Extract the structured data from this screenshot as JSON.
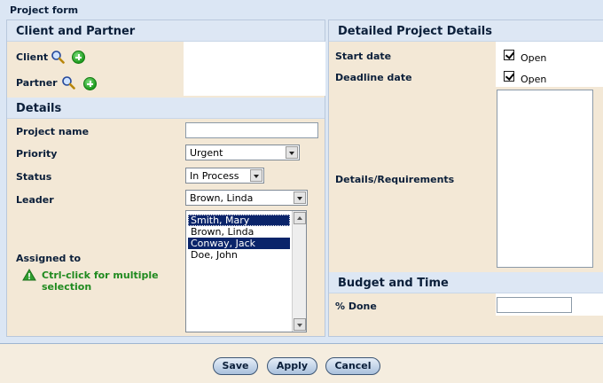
{
  "form": {
    "title": "Project form"
  },
  "client_partner": {
    "header": "Client and Partner",
    "client_label": "Client",
    "partner_label": "Partner"
  },
  "details": {
    "header": "Details",
    "project_name_label": "Project name",
    "project_name_value": "",
    "priority_label": "Priority",
    "priority_value": "Urgent",
    "status_label": "Status",
    "status_value": "In Process",
    "leader_label": "Leader",
    "leader_value": "Brown, Linda",
    "assigned_label": "Assigned to",
    "assigned_hint": "Ctrl-click for multiple selection",
    "assigned_options": [
      {
        "label": "Smith, Mary",
        "selected": true
      },
      {
        "label": "Brown, Linda",
        "selected": false
      },
      {
        "label": "Conway, Jack",
        "selected": true
      },
      {
        "label": "Doe, John",
        "selected": false
      }
    ]
  },
  "project_details": {
    "header": "Detailed Project Details",
    "start_label": "Start date",
    "start_open_label": "Open",
    "start_open_checked": true,
    "deadline_label": "Deadline date",
    "deadline_open_label": "Open",
    "deadline_open_checked": true,
    "requirements_label": "Details/Requirements",
    "requirements_value": ""
  },
  "budget": {
    "header": "Budget and Time",
    "done_label": "% Done",
    "done_value": ""
  },
  "buttons": {
    "save": "Save",
    "apply": "Apply",
    "cancel": "Cancel"
  },
  "colors": {
    "header_bg": "#dde7f4",
    "label_bg": "#f3e8d6",
    "hint_green": "#1f8a1f",
    "selection": "#0a246a"
  }
}
